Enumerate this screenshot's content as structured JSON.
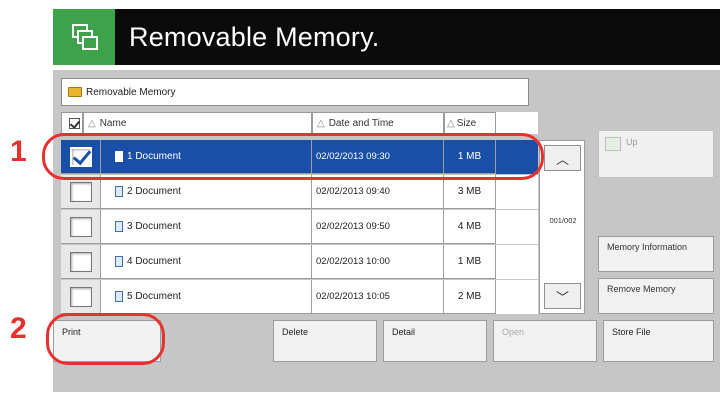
{
  "title": "Removable Memory.",
  "path": "Removable Memory",
  "columns": {
    "name": "Name",
    "date": "Date and Time",
    "size": "Size"
  },
  "files": [
    {
      "name": "1  Document",
      "date": "02/02/2013  09:30",
      "size": "1  MB",
      "selected": true
    },
    {
      "name": "2  Document",
      "date": "02/02/2013  09:40",
      "size": "3  MB",
      "selected": false
    },
    {
      "name": "3  Document",
      "date": "02/02/2013  09:50",
      "size": "4  MB",
      "selected": false
    },
    {
      "name": "4  Document",
      "date": "02/02/2013  10:00",
      "size": "1  MB",
      "selected": false
    },
    {
      "name": "5  Document",
      "date": "02/02/2013  10:05",
      "size": "2  MB",
      "selected": false
    }
  ],
  "page_indicator": "001/002",
  "side": {
    "up": "Up",
    "memory_info": "Memory Information",
    "remove_memory": "Remove Memory"
  },
  "bottom": {
    "print": "Print",
    "delete": "Delete",
    "detail": "Detail",
    "open": "Open",
    "store_file": "Store File"
  },
  "callouts": {
    "one": "1",
    "two": "2"
  },
  "colors": {
    "accent_red": "#e8312f",
    "selection_blue": "#1a4fa7",
    "title_green": "#3ea24a"
  }
}
